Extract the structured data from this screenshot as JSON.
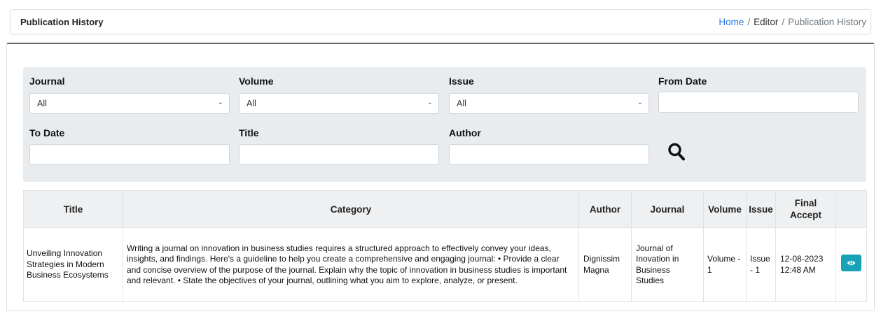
{
  "header": {
    "title": "Publication History",
    "breadcrumb": {
      "home": "Home",
      "sep": "/",
      "editor": "Editor",
      "current": "Publication History"
    }
  },
  "filters": {
    "journal": {
      "label": "Journal",
      "value": "All"
    },
    "volume": {
      "label": "Volume",
      "value": "All"
    },
    "issue": {
      "label": "Issue",
      "value": "All"
    },
    "from_date": {
      "label": "From Date",
      "value": ""
    },
    "to_date": {
      "label": "To Date",
      "value": ""
    },
    "title": {
      "label": "Title",
      "value": ""
    },
    "author": {
      "label": "Author",
      "value": ""
    },
    "search_icon": "search-icon"
  },
  "table": {
    "headers": [
      "Title",
      "Category",
      "Author",
      "Journal",
      "Volume",
      "Issue",
      "Final Accept",
      ""
    ],
    "rows": [
      {
        "title": "Unveiling Innovation Strategies in Modern Business Ecosystems",
        "category": "Writing a journal on innovation in business studies requires a structured approach to effectively convey your ideas, insights, and findings. Here's a guideline to help you create a comprehensive and engaging journal: • Provide a clear and concise overview of the purpose of the journal. Explain why the topic of innovation in business studies is important and relevant. • State the objectives of your journal, outlining what you aim to explore, analyze, or present.",
        "author": "Dignissim Magna",
        "journal": "Journal of Inovation in Business Studies",
        "volume": "Volume - 1",
        "issue": "Issue - 1",
        "final_accept": "12-08-2023 12:48 AM",
        "action_icon": "eye-icon"
      }
    ]
  },
  "colors": {
    "accent": "#17a2b8",
    "link": "#2a7ae2",
    "panel": "#e8ecef"
  }
}
